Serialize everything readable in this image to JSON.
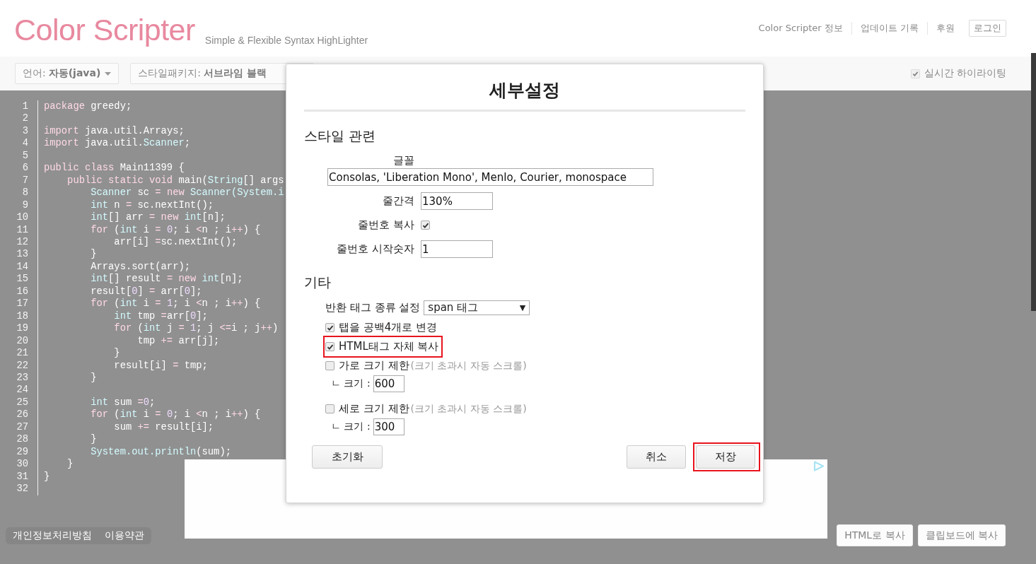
{
  "header": {
    "logo": "Color Scripter",
    "tagline": "Simple & Flexible Syntax HighLighter",
    "nav": [
      {
        "label": "Color Scripter 정보",
        "kind": "link"
      },
      {
        "label": "업데이트 기록",
        "kind": "link"
      },
      {
        "label": "후원",
        "kind": "link"
      },
      {
        "label": "로그인",
        "kind": "button"
      }
    ]
  },
  "toolbar": {
    "dropdowns": [
      {
        "label": "언어:",
        "value": "자동(java)",
        "caret": true
      },
      {
        "label": "스타일패키지:",
        "value": "서브라임 블랙",
        "caret": false
      }
    ],
    "live_highlight": {
      "label": "실시간 하이라이팅",
      "checked": true
    }
  },
  "code": [
    {
      "number": "1",
      "tokens": [
        {
          "kind": "kw",
          "text": "package"
        },
        {
          "kind": "p",
          "text": " greedy;"
        }
      ]
    },
    {
      "number": "2"
    },
    {
      "number": "3",
      "tokens": [
        {
          "kind": "kw",
          "text": "import"
        },
        {
          "kind": "p",
          "text": " java.util.Arrays;"
        }
      ]
    },
    {
      "number": "4",
      "tokens": [
        {
          "kind": "kw",
          "text": "import"
        },
        {
          "kind": "p",
          "text": " java.util."
        },
        {
          "kind": "ty",
          "text": "Scanner"
        },
        {
          "kind": "p",
          "text": ";"
        }
      ]
    },
    {
      "number": "5"
    },
    {
      "number": "6",
      "tokens": [
        {
          "kind": "kw",
          "text": "public class"
        },
        {
          "kind": "p",
          "text": " Main11399 {"
        }
      ]
    },
    {
      "number": "7",
      "tokens": [
        {
          "kind": "kw",
          "text": "    public static void"
        },
        {
          "kind": "p",
          "text": " main("
        },
        {
          "kind": "ty",
          "text": "String"
        },
        {
          "kind": "p",
          "text": "[] args"
        }
      ]
    },
    {
      "number": "8",
      "tokens": [
        {
          "kind": "ty",
          "text": "        Scanner"
        },
        {
          "kind": "p",
          "text": " sc "
        },
        {
          "kind": "op",
          "text": "="
        },
        {
          "kind": "kw",
          "text": " new"
        },
        {
          "kind": "ty",
          "text": " Scanner(System.i"
        }
      ]
    },
    {
      "number": "9",
      "tokens": [
        {
          "kind": "ty",
          "text": "        int"
        },
        {
          "kind": "p",
          "text": " n "
        },
        {
          "kind": "op",
          "text": "="
        },
        {
          "kind": "p",
          "text": " sc.nextInt();"
        }
      ]
    },
    {
      "number": "10",
      "tokens": [
        {
          "kind": "ty",
          "text": "        int"
        },
        {
          "kind": "p",
          "text": "[] arr "
        },
        {
          "kind": "op",
          "text": "="
        },
        {
          "kind": "kw",
          "text": " new"
        },
        {
          "kind": "ty",
          "text": " int"
        },
        {
          "kind": "p",
          "text": "[n];"
        }
      ]
    },
    {
      "number": "11",
      "tokens": [
        {
          "kind": "kw",
          "text": "        for"
        },
        {
          "kind": "p",
          "text": " ("
        },
        {
          "kind": "ty",
          "text": "int"
        },
        {
          "kind": "p",
          "text": " i "
        },
        {
          "kind": "op",
          "text": "="
        },
        {
          "kind": "num",
          "text": " 0"
        },
        {
          "kind": "p",
          "text": "; i "
        },
        {
          "kind": "op",
          "text": "<"
        },
        {
          "kind": "p",
          "text": "n ; i"
        },
        {
          "kind": "op",
          "text": "++"
        },
        {
          "kind": "p",
          "text": ") {"
        }
      ]
    },
    {
      "number": "12",
      "tokens": [
        {
          "kind": "p",
          "text": "            arr[i] "
        },
        {
          "kind": "op",
          "text": "="
        },
        {
          "kind": "p",
          "text": "sc.nextInt();"
        }
      ]
    },
    {
      "number": "13",
      "tokens": [
        {
          "kind": "p",
          "text": "        }"
        }
      ]
    },
    {
      "number": "14",
      "tokens": [
        {
          "kind": "p",
          "text": "        Arrays.sort(arr);"
        }
      ]
    },
    {
      "number": "15",
      "tokens": [
        {
          "kind": "ty",
          "text": "        int"
        },
        {
          "kind": "p",
          "text": "[] result "
        },
        {
          "kind": "op",
          "text": "="
        },
        {
          "kind": "kw",
          "text": " new"
        },
        {
          "kind": "ty",
          "text": " int"
        },
        {
          "kind": "p",
          "text": "[n];"
        }
      ]
    },
    {
      "number": "16",
      "tokens": [
        {
          "kind": "p",
          "text": "        result["
        },
        {
          "kind": "num",
          "text": "0"
        },
        {
          "kind": "p",
          "text": "] "
        },
        {
          "kind": "op",
          "text": "="
        },
        {
          "kind": "p",
          "text": " arr["
        },
        {
          "kind": "num",
          "text": "0"
        },
        {
          "kind": "p",
          "text": "];"
        }
      ]
    },
    {
      "number": "17",
      "tokens": [
        {
          "kind": "kw",
          "text": "        for"
        },
        {
          "kind": "p",
          "text": " ("
        },
        {
          "kind": "ty",
          "text": "int"
        },
        {
          "kind": "p",
          "text": " i "
        },
        {
          "kind": "op",
          "text": "="
        },
        {
          "kind": "num",
          "text": " 1"
        },
        {
          "kind": "p",
          "text": "; i "
        },
        {
          "kind": "op",
          "text": "<"
        },
        {
          "kind": "p",
          "text": "n ; i"
        },
        {
          "kind": "op",
          "text": "++"
        },
        {
          "kind": "p",
          "text": ") {"
        }
      ]
    },
    {
      "number": "18",
      "tokens": [
        {
          "kind": "ty",
          "text": "            int"
        },
        {
          "kind": "p",
          "text": " tmp "
        },
        {
          "kind": "op",
          "text": "="
        },
        {
          "kind": "p",
          "text": "arr["
        },
        {
          "kind": "num",
          "text": "0"
        },
        {
          "kind": "p",
          "text": "];"
        }
      ]
    },
    {
      "number": "19",
      "tokens": [
        {
          "kind": "kw",
          "text": "            for"
        },
        {
          "kind": "p",
          "text": " ("
        },
        {
          "kind": "ty",
          "text": "int"
        },
        {
          "kind": "p",
          "text": " j "
        },
        {
          "kind": "op",
          "text": "="
        },
        {
          "kind": "num",
          "text": " 1"
        },
        {
          "kind": "p",
          "text": "; j "
        },
        {
          "kind": "op",
          "text": "<="
        },
        {
          "kind": "p",
          "text": "i ; j"
        },
        {
          "kind": "op",
          "text": "++"
        },
        {
          "kind": "p",
          "text": ")"
        }
      ]
    },
    {
      "number": "20",
      "tokens": [
        {
          "kind": "p",
          "text": "                tmp "
        },
        {
          "kind": "op",
          "text": "+="
        },
        {
          "kind": "p",
          "text": " arr[j];"
        }
      ]
    },
    {
      "number": "21",
      "tokens": [
        {
          "kind": "p",
          "text": "            }"
        }
      ]
    },
    {
      "number": "22",
      "tokens": [
        {
          "kind": "p",
          "text": "            result[i] "
        },
        {
          "kind": "op",
          "text": "="
        },
        {
          "kind": "p",
          "text": " tmp;"
        }
      ]
    },
    {
      "number": "23",
      "tokens": [
        {
          "kind": "p",
          "text": "        }"
        }
      ]
    },
    {
      "number": "24"
    },
    {
      "number": "25",
      "tokens": [
        {
          "kind": "ty",
          "text": "        int"
        },
        {
          "kind": "p",
          "text": " sum "
        },
        {
          "kind": "op",
          "text": "="
        },
        {
          "kind": "num",
          "text": "0"
        },
        {
          "kind": "p",
          "text": ";"
        }
      ]
    },
    {
      "number": "26",
      "tokens": [
        {
          "kind": "kw",
          "text": "        for"
        },
        {
          "kind": "p",
          "text": " ("
        },
        {
          "kind": "ty",
          "text": "int"
        },
        {
          "kind": "p",
          "text": " i "
        },
        {
          "kind": "op",
          "text": "="
        },
        {
          "kind": "num",
          "text": " 0"
        },
        {
          "kind": "p",
          "text": "; i "
        },
        {
          "kind": "op",
          "text": "<"
        },
        {
          "kind": "p",
          "text": "n ; i"
        },
        {
          "kind": "op",
          "text": "++"
        },
        {
          "kind": "p",
          "text": ") {"
        }
      ]
    },
    {
      "number": "27",
      "tokens": [
        {
          "kind": "p",
          "text": "            sum "
        },
        {
          "kind": "op",
          "text": "+="
        },
        {
          "kind": "p",
          "text": " result[i];"
        }
      ]
    },
    {
      "number": "28",
      "tokens": [
        {
          "kind": "p",
          "text": "        }"
        }
      ]
    },
    {
      "number": "29",
      "tokens": [
        {
          "kind": "ty",
          "text": "        System.out.println"
        },
        {
          "kind": "p",
          "text": "(sum);"
        }
      ]
    },
    {
      "number": "30",
      "tokens": [
        {
          "kind": "p",
          "text": "    }"
        }
      ]
    },
    {
      "number": "31",
      "tokens": [
        {
          "kind": "p",
          "text": "}"
        }
      ]
    },
    {
      "number": "32"
    }
  ],
  "footer": {
    "links": [
      "개인정보처리방침",
      "이용약관"
    ],
    "buttons": [
      {
        "label": "HTML로 복사"
      },
      {
        "label": "클립보드에 복사"
      }
    ]
  },
  "dialog": {
    "title": "세부설정",
    "sections": [
      {
        "heading": "스타일 관련",
        "fields": [
          {
            "kind": "text_stacked",
            "label": "글꼴",
            "value": "Consolas, 'Liberation Mono', Menlo, Courier, monospace"
          },
          {
            "kind": "text",
            "label": "줄간격",
            "value": "130%"
          },
          {
            "kind": "checkbox",
            "label": "줄번호 복사",
            "checked": true
          },
          {
            "kind": "text",
            "label": "줄번호 시작숫자",
            "value": "1"
          }
        ]
      },
      {
        "heading": "기타",
        "fields": [
          {
            "kind": "select",
            "label": "반환 태그 종류 설정",
            "value": "span 태그",
            "arrow": "▼"
          },
          {
            "kind": "checkbox",
            "label": "탭을 공백4개로 변경",
            "checked": true,
            "highlighted": false
          },
          {
            "kind": "checkbox",
            "label": "HTML태그 자체 복사",
            "checked": true,
            "highlighted": true
          },
          {
            "kind": "limit",
            "label": "가로 크기 제한",
            "note": "(크기 초과시 자동 스크롤)",
            "checked": false,
            "size_label": "ㄴ 크기 :",
            "value": "600"
          },
          {
            "kind": "limit",
            "label": "세로 크기 제한",
            "note": "(크기 초과시 자동 스크롤)",
            "checked": false,
            "size_label": "ㄴ 크기 :",
            "value": "300"
          }
        ]
      }
    ],
    "left_buttons": [
      {
        "label": "초기화",
        "highlighted": false
      }
    ],
    "right_buttons": [
      {
        "label": "취소",
        "highlighted": false
      },
      {
        "label": "저장",
        "highlighted": true
      }
    ]
  }
}
